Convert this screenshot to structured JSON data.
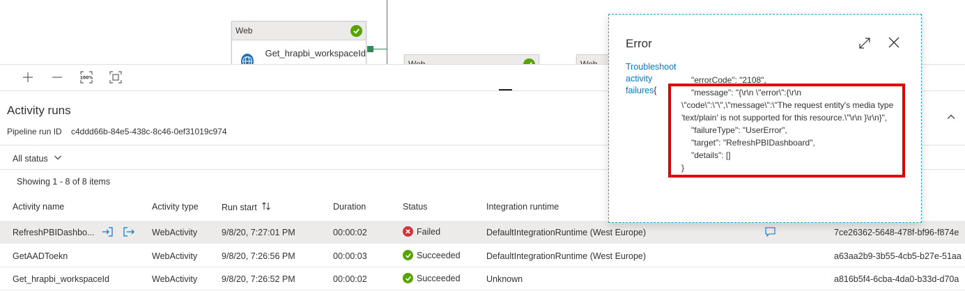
{
  "canvas": {
    "node_type": "Web",
    "node_name": "Get_hrapbi_workspaceId",
    "ghost_1_type": "Web",
    "ghost_2_type": "Web"
  },
  "panel": {
    "title": "Activity runs",
    "run_id_label": "Pipeline run ID",
    "run_id_value": "c4ddd66b-84e5-438c-8c46-0ef31019c974",
    "status_filter": "All status",
    "showing": "Showing 1 - 8 of 8 items"
  },
  "table": {
    "columns": [
      "Activity name",
      "Activity type",
      "Run start",
      "Duration",
      "Status",
      "Integration runtime"
    ],
    "rows": [
      {
        "name": "RefreshPBIDashbo...",
        "type": "WebActivity",
        "start": "9/8/20, 7:27:01 PM",
        "duration": "00:00:02",
        "status": "Failed",
        "runtime": "DefaultIntegrationRuntime (West Europe)",
        "run_id": "7ce26362-5648-478f-bf96-f874e"
      },
      {
        "name": "GetAADToekn",
        "type": "WebActivity",
        "start": "9/8/20, 7:26:56 PM",
        "duration": "00:00:03",
        "status": "Succeeded",
        "runtime": "DefaultIntegrationRuntime (West Europe)",
        "run_id": "a63aa2b9-3b55-4cb5-b27e-51aa"
      },
      {
        "name": "Get_hrapbi_workspaceId",
        "type": "WebActivity",
        "start": "9/8/20, 7:26:52 PM",
        "duration": "00:00:02",
        "status": "Succeeded",
        "runtime": "Unknown",
        "run_id": "a816b5f4-6cba-4da0-b33d-d70a"
      }
    ]
  },
  "error": {
    "title": "Error",
    "troubleshoot": "Troubleshoot activity failures",
    "open_brace": "{",
    "error_code": "\"errorCode\": \"2108\",",
    "message": "\"message\": \"{\\r\\n  \\\"error\\\":{\\r\\n \\\"code\\\":\\\"\\\",\\\"message\\\":\\\"The request entity's media type 'text/plain' is not supported for this resource.\\\"\\r\\n }\\r\\n}\",",
    "failure_type": "\"failureType\": \"UserError\",",
    "target": "\"target\": \"RefreshPBIDashboard\",",
    "details": "\"details\": []",
    "close_brace": "}"
  },
  "colors": {
    "accent": "#0078d4",
    "success": "#57a300",
    "failed": "#d13438",
    "highlight": "#e50000",
    "popup_border": "#1ea1d9"
  },
  "icons": [
    "check-icon",
    "http-globe-icon",
    "plus-icon",
    "minus-icon",
    "zoom-100-icon",
    "fit-screen-icon",
    "chevron-up-icon",
    "chevron-down-icon",
    "sort-icon",
    "input-icon",
    "output-icon",
    "error-icon",
    "success-icon",
    "comment-icon",
    "expand-icon",
    "close-icon"
  ]
}
